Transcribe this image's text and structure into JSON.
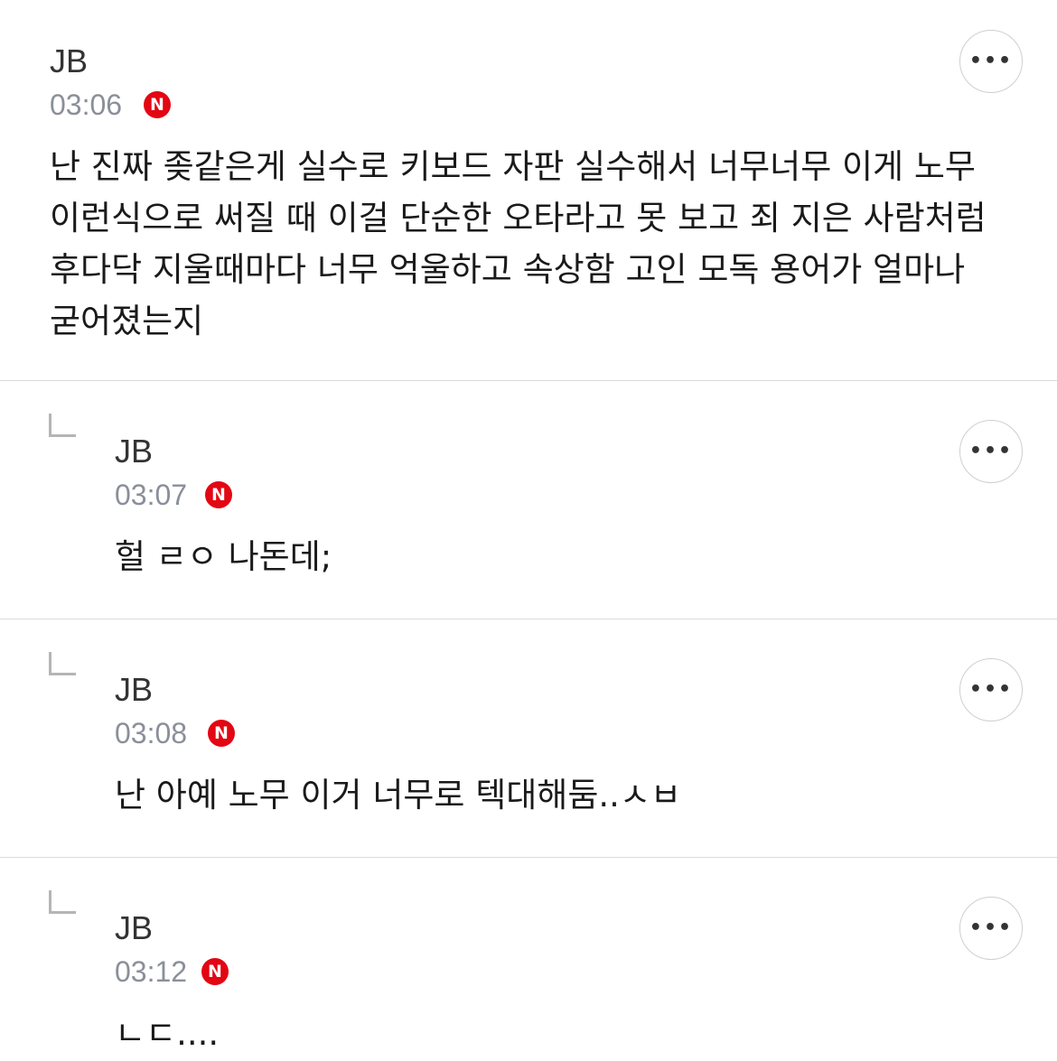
{
  "comments": [
    {
      "author": "JB",
      "time": "03:06",
      "badge": "N",
      "text": "난 진짜 좆같은게 실수로 키보드 자판 실수해서 너무너무 이게 노무 이런식으로 써질 때 이걸 단순한 오타라고 못 보고 죄 지은 사람처럼 후다닥 지울때마다 너무 억울하고 속상함 고인 모독 용어가 얼마나 굳어졌는지",
      "more_icon": "more-horizontal-icon"
    },
    {
      "author": "JB",
      "time": "03:07",
      "badge": "N",
      "text": "헐 ㄹㅇ 나돈데;",
      "reply_icon": "reply-arrow-icon",
      "more_icon": "more-horizontal-icon"
    },
    {
      "author": "JB",
      "time": "03:08",
      "badge": "N",
      "text": "난 아예 노무 이거 너무로 텍대해둠..ㅅㅂ",
      "reply_icon": "reply-arrow-icon",
      "more_icon": "more-horizontal-icon"
    },
    {
      "author": "JB",
      "time": "03:12",
      "badge": "N",
      "text": "ㄴㄷ....",
      "reply_icon": "reply-arrow-icon",
      "more_icon": "more-horizontal-icon"
    }
  ],
  "more_label": "•••",
  "colors": {
    "badge": "#e30613",
    "divider": "#dcdcdc",
    "time": "#8a8f99"
  }
}
